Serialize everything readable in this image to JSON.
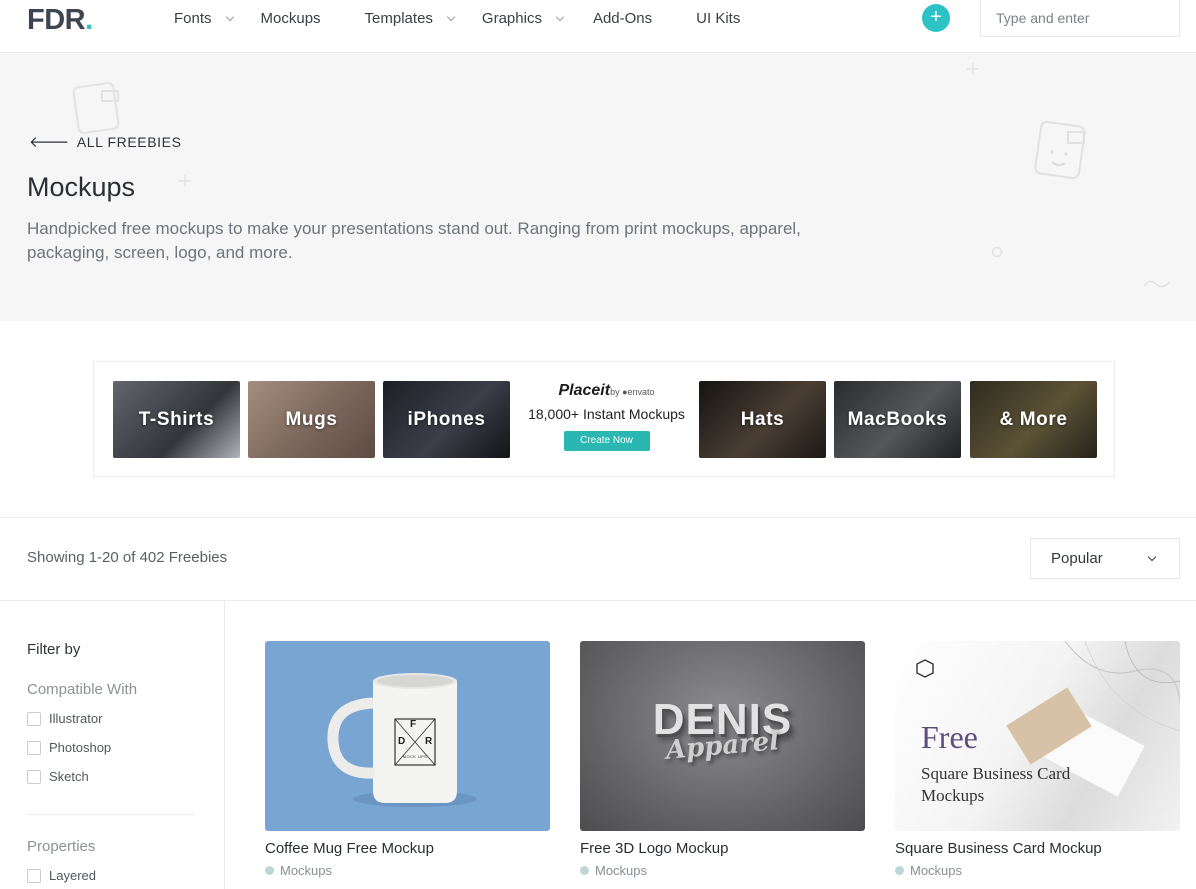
{
  "header": {
    "logo_text": "FDR",
    "logo_dot": ".",
    "nav": [
      {
        "label": "Fonts",
        "has_dropdown": true
      },
      {
        "label": "Mockups",
        "has_dropdown": false
      },
      {
        "label": "Templates",
        "has_dropdown": true
      },
      {
        "label": "Graphics",
        "has_dropdown": true
      },
      {
        "label": "Add-Ons",
        "has_dropdown": false
      },
      {
        "label": "UI Kits",
        "has_dropdown": false
      }
    ],
    "plus_icon": "plus-icon",
    "plus_glyph": "+",
    "search_placeholder": "Type and enter",
    "accent_color": "#2dc3c6"
  },
  "hero": {
    "back_arrow": "🡐",
    "back_label": "ALL FREEBIES",
    "title": "Mockups",
    "description": "Handpicked free mockups to make your presentations stand out. Ranging from print mockups, apparel, packaging, screen, logo, and more."
  },
  "banner": {
    "tiles": [
      {
        "label": "T-Shirts",
        "color": "#4a4d55"
      },
      {
        "label": "Mugs",
        "color": "#8a7469"
      },
      {
        "label": "iPhones",
        "color": "#2c2e35"
      },
      {
        "label": "Hats",
        "color": "#2f2a26"
      },
      {
        "label": "MacBooks",
        "color": "#3a3b3e"
      },
      {
        "label": "& More",
        "color": "#3e3a2c"
      }
    ],
    "brand": "Placeit",
    "brand_by": "by ●envato",
    "count_text": "18,000+ Instant Mockups",
    "cta_label": "Create Now",
    "cta_color": "#2ab7b2"
  },
  "results": {
    "count_text": "Showing 1-20 of 402 Freebies",
    "sort_value": "Popular"
  },
  "sidebar": {
    "title": "Filter by",
    "groups": [
      {
        "title": "Compatible With",
        "options": [
          "Illustrator",
          "Photoshop",
          "Sketch"
        ]
      },
      {
        "title": "Properties",
        "options": [
          "Layered"
        ]
      }
    ]
  },
  "cards": [
    {
      "title": "Coffee Mug Free Mockup",
      "tag": "Mockups",
      "thumb_color": "#79a5d3",
      "mug_letters": [
        "F",
        "D",
        "R"
      ],
      "mug_sub": "MOCK UPS"
    },
    {
      "title": "Free 3D Logo Mockup",
      "tag": "Mockups",
      "thumb_color": "#6d6d6f",
      "logo_main": "DENIS",
      "logo_sub": "Apparel"
    },
    {
      "title": "Square Business Card Mockup",
      "tag": "Mockups",
      "thumb_color": "#eeeeee",
      "card_heading": "Free",
      "card_line1": "Square Business Card",
      "card_line2": "Mockups"
    }
  ]
}
